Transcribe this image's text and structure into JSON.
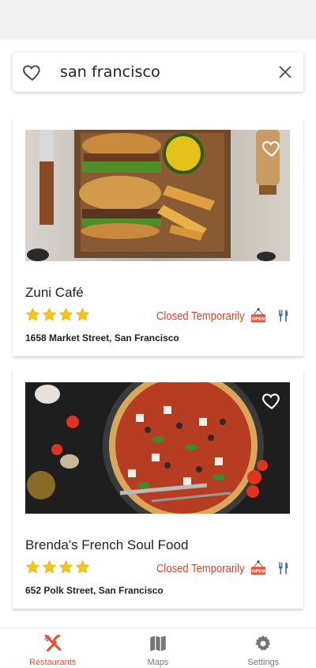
{
  "search": {
    "query": "san francisco"
  },
  "restaurants": [
    {
      "name": "Zuni Café",
      "rating": 4,
      "status": "Closed Temporarily",
      "address": "1658 Market Street, San Francisco",
      "open_sign_text": "OPEN"
    },
    {
      "name": "Brenda's French Soul Food",
      "rating": 4,
      "status": "Closed Temporarily",
      "address": "652 Polk Street, San Francisco",
      "open_sign_text": "OPEN"
    }
  ],
  "nav": {
    "items": [
      {
        "label": "Restaurants",
        "icon": "fork-knife-icon",
        "active": true
      },
      {
        "label": "Maps",
        "icon": "map-icon",
        "active": false
      },
      {
        "label": "Settings",
        "icon": "gear-icon",
        "active": false
      }
    ]
  },
  "colors": {
    "accent": "#e8533a",
    "status_closed": "#d1432e",
    "star": "#f5c518",
    "utensils": "#2b6cb0",
    "icon_gray": "#757575"
  }
}
